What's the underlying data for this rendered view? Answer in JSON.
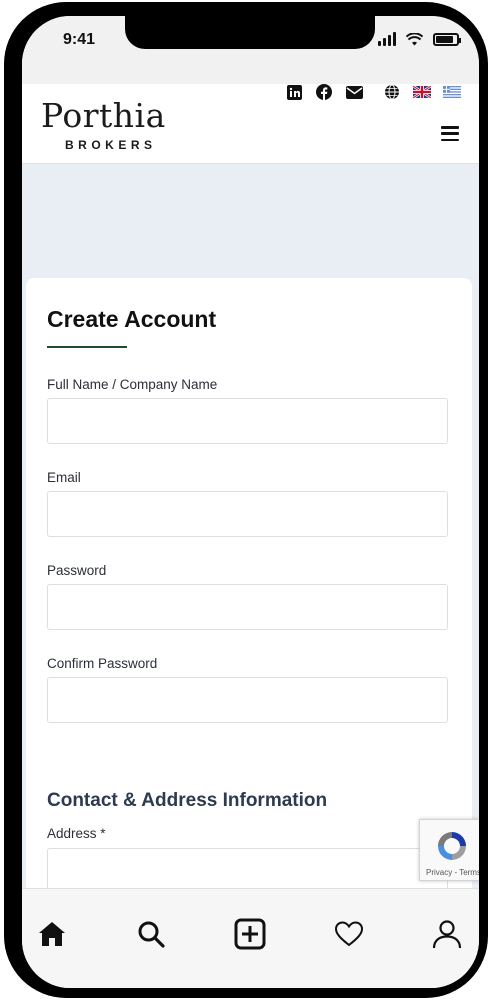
{
  "status": {
    "time": "9:41"
  },
  "brand": {
    "name": "Porthia",
    "subtitle": "BROKERS"
  },
  "header": {
    "social_icons": [
      "linkedin-icon",
      "facebook-icon",
      "mail-icon"
    ],
    "language_icons": [
      "globe-icon",
      "uk-flag-icon",
      "greek-flag-icon"
    ]
  },
  "form": {
    "title": "Create Account",
    "fields": [
      {
        "label": "Full Name / Company Name",
        "value": "",
        "placeholder": ""
      },
      {
        "label": "Email",
        "value": "",
        "placeholder": ""
      },
      {
        "label": "Password",
        "value": "",
        "placeholder": ""
      },
      {
        "label": "Confirm Password",
        "value": "",
        "placeholder": ""
      }
    ],
    "contact_section_title": "Contact & Address Information",
    "address_label": "Address *"
  },
  "recaptcha": {
    "text": "Privacy - Terms"
  },
  "tabbar": {
    "items": [
      "home-icon",
      "search-icon",
      "add-icon",
      "heart-icon",
      "profile-icon"
    ]
  },
  "colors": {
    "accent_underline": "#1f4d2a",
    "heading": "#2e3a50"
  }
}
